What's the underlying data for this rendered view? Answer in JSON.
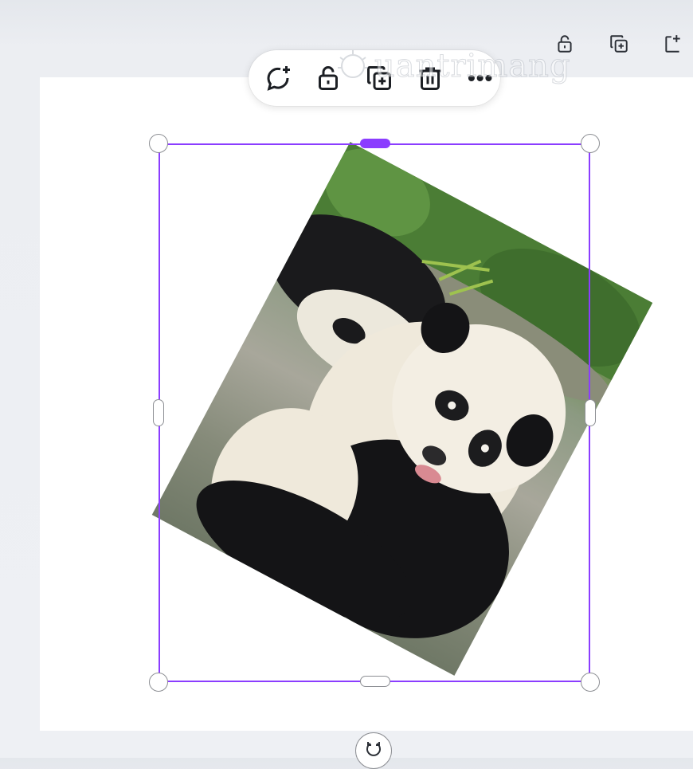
{
  "page_toolbar": {
    "icons": [
      "unlock-icon",
      "duplicate-icon",
      "add-page-icon"
    ]
  },
  "floating_toolbar": {
    "icons": [
      "add-comment-icon",
      "unlock-icon",
      "duplicate-icon",
      "trash-icon",
      "more-icon"
    ],
    "more_label": "•••"
  },
  "watermark": {
    "text": "uantrimang"
  },
  "selection": {
    "color": "#8b3dff"
  },
  "image": {
    "subject": "panda-photo"
  }
}
